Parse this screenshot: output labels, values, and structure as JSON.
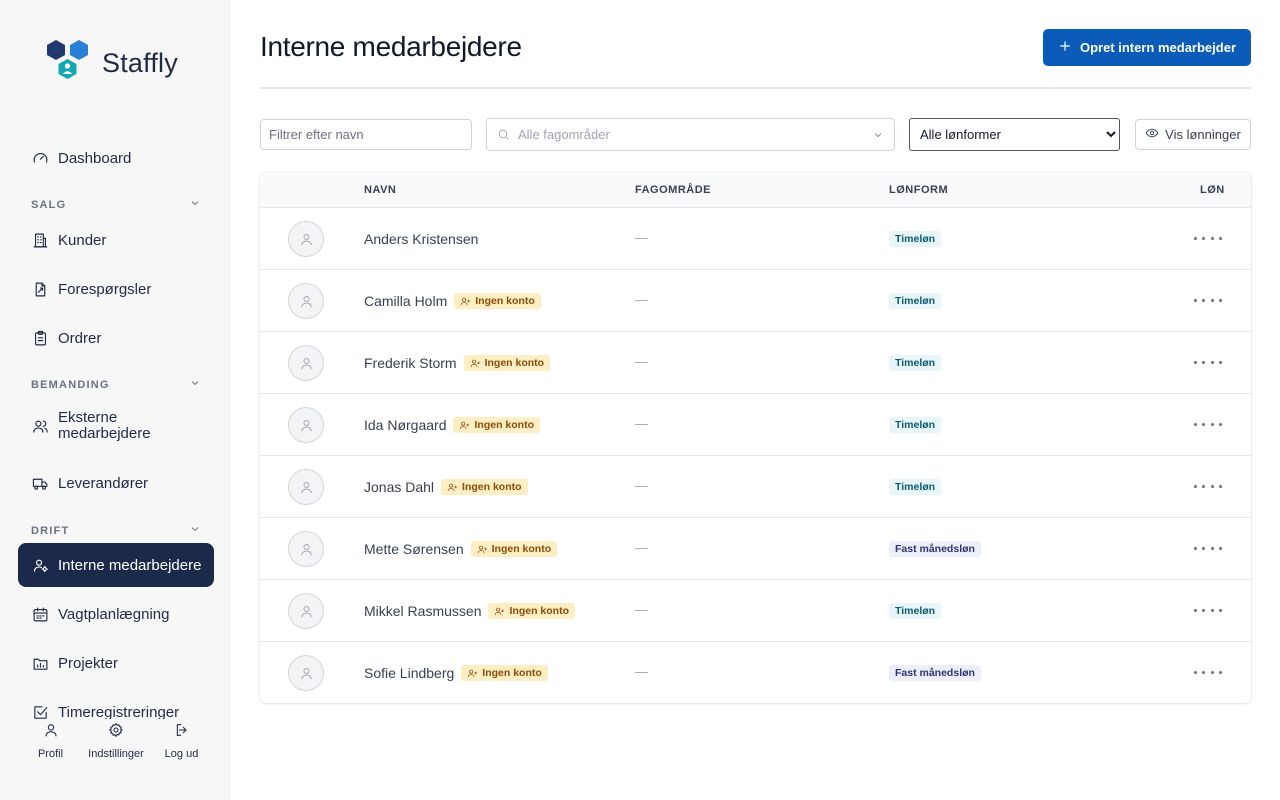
{
  "brand": {
    "name": "Staffly"
  },
  "sidebar": {
    "dashboard": "Dashboard",
    "sections": [
      {
        "label": "SALG"
      },
      {
        "label": "BEMANDING"
      },
      {
        "label": "DRIFT"
      }
    ],
    "items": {
      "kunder": "Kunder",
      "foresporgsler": "Forespørgsler",
      "ordrer": "Ordrer",
      "eksterne": "Eksterne medarbejdere",
      "leverandorer": "Leverandører",
      "interne": "Interne medarbejdere",
      "vagtplan": "Vagtplanlægning",
      "projekter": "Projekter",
      "timeregistreringer": "Timeregistreringer"
    },
    "active_item": "Interne medarbejdere",
    "footer": {
      "profil": "Profil",
      "indstillinger": "Indstillinger",
      "log_ud": "Log ud"
    }
  },
  "page": {
    "title": "Interne medarbejdere",
    "create_button": "Opret intern medarbejder"
  },
  "filters": {
    "name_placeholder": "Filtrer efter navn",
    "area_placeholder": "Alle fagområder",
    "salary_type_selected": "Alle lønformer",
    "salary_type_options": [
      "Alle lønformer"
    ],
    "show_salaries_button": "Vis lønninger"
  },
  "table": {
    "columns": {
      "navn": "NAVN",
      "fagomrade": "FAGOMRÅDE",
      "lonform": "LØNFORM",
      "lon": "LØN"
    },
    "no_account_label": "Ingen konto",
    "empty_value": "—",
    "rows": [
      {
        "name": "Anders Kristensen",
        "no_account": false,
        "area": "—",
        "salary_type": "Timeløn"
      },
      {
        "name": "Camilla Holm",
        "no_account": true,
        "area": "—",
        "salary_type": "Timeløn"
      },
      {
        "name": "Frederik Storm",
        "no_account": true,
        "area": "—",
        "salary_type": "Timeløn"
      },
      {
        "name": "Ida Nørgaard",
        "no_account": true,
        "area": "—",
        "salary_type": "Timeløn"
      },
      {
        "name": "Jonas Dahl",
        "no_account": true,
        "area": "—",
        "salary_type": "Timeløn"
      },
      {
        "name": "Mette Sørensen",
        "no_account": true,
        "area": "—",
        "salary_type": "Fast månedsløn"
      },
      {
        "name": "Mikkel Rasmussen",
        "no_account": true,
        "area": "—",
        "salary_type": "Timeløn"
      },
      {
        "name": "Sofie Lindberg",
        "no_account": true,
        "area": "—",
        "salary_type": "Fast månedsløn"
      }
    ]
  },
  "colors": {
    "primary": "#0b5cb8",
    "sidebar_active": "#1b2a4a",
    "badge_no_account_bg": "#fdefc3",
    "badge_hourly_bg": "#e8f6fa",
    "badge_monthly_bg": "#eceef8"
  }
}
